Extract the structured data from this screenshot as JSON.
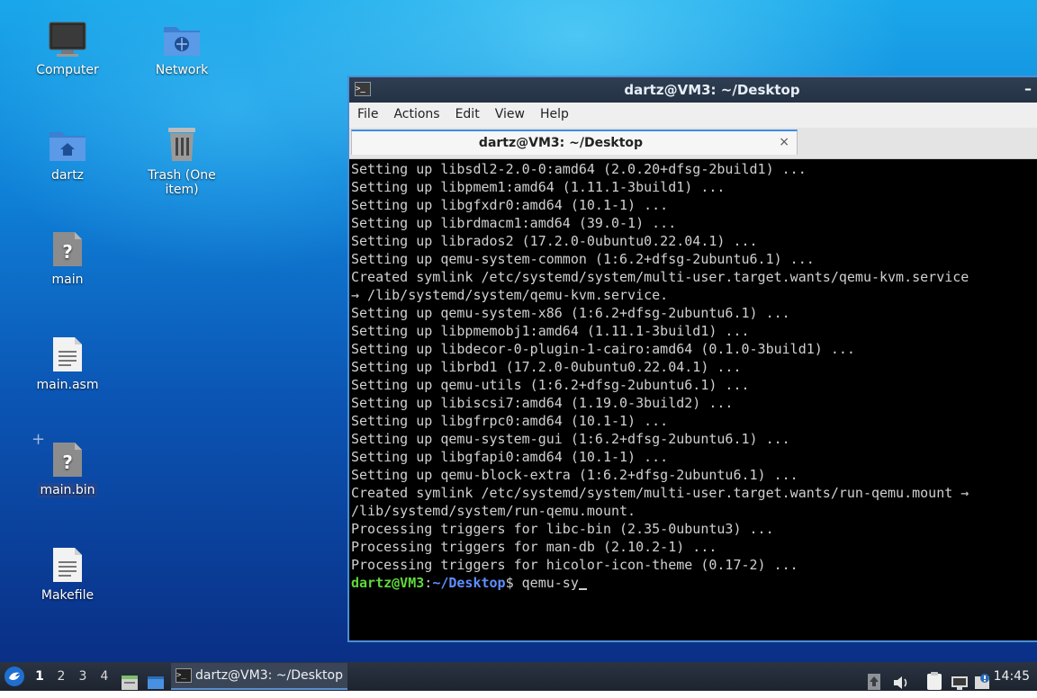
{
  "desktop": {
    "icons": [
      {
        "label": "Computer"
      },
      {
        "label": "Network"
      },
      {
        "label": "dartz"
      },
      {
        "label": "Trash (One item)"
      },
      {
        "label": "main"
      },
      {
        "label": "main.asm"
      },
      {
        "label": "main.bin"
      },
      {
        "label": "Makefile"
      }
    ]
  },
  "terminal": {
    "window_title": "dartz@VM3: ~/Desktop",
    "title_icon": ">_",
    "menu": [
      "File",
      "Actions",
      "Edit",
      "View",
      "Help"
    ],
    "tab": {
      "label": "dartz@VM3: ~/Desktop",
      "close": "×"
    },
    "minimize": "–",
    "lines": [
      "Setting up libsdl2-2.0-0:amd64 (2.0.20+dfsg-2build1) ...",
      "Setting up libpmem1:amd64 (1.11.1-3build1) ...",
      "Setting up libgfxdr0:amd64 (10.1-1) ...",
      "Setting up librdmacm1:amd64 (39.0-1) ...",
      "Setting up librados2 (17.2.0-0ubuntu0.22.04.1) ...",
      "Setting up qemu-system-common (1:6.2+dfsg-2ubuntu6.1) ...",
      "Created symlink /etc/systemd/system/multi-user.target.wants/qemu-kvm.service",
      "→ /lib/systemd/system/qemu-kvm.service.",
      "Setting up qemu-system-x86 (1:6.2+dfsg-2ubuntu6.1) ...",
      "Setting up libpmemobj1:amd64 (1.11.1-3build1) ...",
      "Setting up libdecor-0-plugin-1-cairo:amd64 (0.1.0-3build1) ...",
      "Setting up librbd1 (17.2.0-0ubuntu0.22.04.1) ...",
      "Setting up qemu-utils (1:6.2+dfsg-2ubuntu6.1) ...",
      "Setting up libiscsi7:amd64 (1.19.0-3build2) ...",
      "Setting up libgfrpc0:amd64 (10.1-1) ...",
      "Setting up qemu-system-gui (1:6.2+dfsg-2ubuntu6.1) ...",
      "Setting up libgfapi0:amd64 (10.1-1) ...",
      "Setting up qemu-block-extra (1:6.2+dfsg-2ubuntu6.1) ...",
      "Created symlink /etc/systemd/system/multi-user.target.wants/run-qemu.mount →",
      "/lib/systemd/system/run-qemu.mount.",
      "Processing triggers for libc-bin (2.35-0ubuntu3) ...",
      "Processing triggers for man-db (2.10.2-1) ...",
      "Processing triggers for hicolor-icon-theme (0.17-2) ..."
    ],
    "prompt": {
      "user": "dartz@VM3",
      "sep": ":",
      "path": "~/Desktop",
      "symbol": "$",
      "command": " qemu-sy"
    }
  },
  "taskbar": {
    "workspaces": [
      "1",
      "2",
      "3",
      "4"
    ],
    "active_workspace": "1",
    "task_label": "dartz@VM3: ~/Desktop",
    "task_icon": ">_",
    "clock": "14:45",
    "tray_icons": [
      "upload-icon",
      "volume-icon",
      "clipboard-icon",
      "network-icon",
      "update-notifier-icon"
    ]
  },
  "colors": {
    "prompt_user": "#5fd83b",
    "prompt_path": "#5f8fff",
    "accent": "#3d8ee6"
  }
}
